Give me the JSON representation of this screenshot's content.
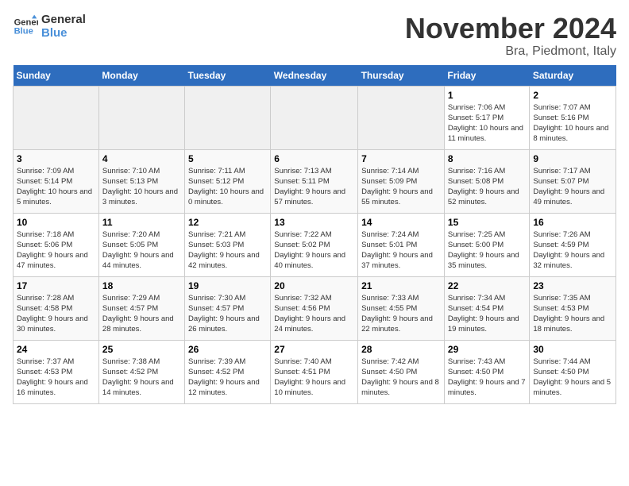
{
  "logo": {
    "line1": "General",
    "line2": "Blue"
  },
  "title": "November 2024",
  "location": "Bra, Piedmont, Italy",
  "weekdays": [
    "Sunday",
    "Monday",
    "Tuesday",
    "Wednesday",
    "Thursday",
    "Friday",
    "Saturday"
  ],
  "weeks": [
    [
      {
        "day": "",
        "info": ""
      },
      {
        "day": "",
        "info": ""
      },
      {
        "day": "",
        "info": ""
      },
      {
        "day": "",
        "info": ""
      },
      {
        "day": "",
        "info": ""
      },
      {
        "day": "1",
        "info": "Sunrise: 7:06 AM\nSunset: 5:17 PM\nDaylight: 10 hours and 11 minutes."
      },
      {
        "day": "2",
        "info": "Sunrise: 7:07 AM\nSunset: 5:16 PM\nDaylight: 10 hours and 8 minutes."
      }
    ],
    [
      {
        "day": "3",
        "info": "Sunrise: 7:09 AM\nSunset: 5:14 PM\nDaylight: 10 hours and 5 minutes."
      },
      {
        "day": "4",
        "info": "Sunrise: 7:10 AM\nSunset: 5:13 PM\nDaylight: 10 hours and 3 minutes."
      },
      {
        "day": "5",
        "info": "Sunrise: 7:11 AM\nSunset: 5:12 PM\nDaylight: 10 hours and 0 minutes."
      },
      {
        "day": "6",
        "info": "Sunrise: 7:13 AM\nSunset: 5:11 PM\nDaylight: 9 hours and 57 minutes."
      },
      {
        "day": "7",
        "info": "Sunrise: 7:14 AM\nSunset: 5:09 PM\nDaylight: 9 hours and 55 minutes."
      },
      {
        "day": "8",
        "info": "Sunrise: 7:16 AM\nSunset: 5:08 PM\nDaylight: 9 hours and 52 minutes."
      },
      {
        "day": "9",
        "info": "Sunrise: 7:17 AM\nSunset: 5:07 PM\nDaylight: 9 hours and 49 minutes."
      }
    ],
    [
      {
        "day": "10",
        "info": "Sunrise: 7:18 AM\nSunset: 5:06 PM\nDaylight: 9 hours and 47 minutes."
      },
      {
        "day": "11",
        "info": "Sunrise: 7:20 AM\nSunset: 5:05 PM\nDaylight: 9 hours and 44 minutes."
      },
      {
        "day": "12",
        "info": "Sunrise: 7:21 AM\nSunset: 5:03 PM\nDaylight: 9 hours and 42 minutes."
      },
      {
        "day": "13",
        "info": "Sunrise: 7:22 AM\nSunset: 5:02 PM\nDaylight: 9 hours and 40 minutes."
      },
      {
        "day": "14",
        "info": "Sunrise: 7:24 AM\nSunset: 5:01 PM\nDaylight: 9 hours and 37 minutes."
      },
      {
        "day": "15",
        "info": "Sunrise: 7:25 AM\nSunset: 5:00 PM\nDaylight: 9 hours and 35 minutes."
      },
      {
        "day": "16",
        "info": "Sunrise: 7:26 AM\nSunset: 4:59 PM\nDaylight: 9 hours and 32 minutes."
      }
    ],
    [
      {
        "day": "17",
        "info": "Sunrise: 7:28 AM\nSunset: 4:58 PM\nDaylight: 9 hours and 30 minutes."
      },
      {
        "day": "18",
        "info": "Sunrise: 7:29 AM\nSunset: 4:57 PM\nDaylight: 9 hours and 28 minutes."
      },
      {
        "day": "19",
        "info": "Sunrise: 7:30 AM\nSunset: 4:57 PM\nDaylight: 9 hours and 26 minutes."
      },
      {
        "day": "20",
        "info": "Sunrise: 7:32 AM\nSunset: 4:56 PM\nDaylight: 9 hours and 24 minutes."
      },
      {
        "day": "21",
        "info": "Sunrise: 7:33 AM\nSunset: 4:55 PM\nDaylight: 9 hours and 22 minutes."
      },
      {
        "day": "22",
        "info": "Sunrise: 7:34 AM\nSunset: 4:54 PM\nDaylight: 9 hours and 19 minutes."
      },
      {
        "day": "23",
        "info": "Sunrise: 7:35 AM\nSunset: 4:53 PM\nDaylight: 9 hours and 18 minutes."
      }
    ],
    [
      {
        "day": "24",
        "info": "Sunrise: 7:37 AM\nSunset: 4:53 PM\nDaylight: 9 hours and 16 minutes."
      },
      {
        "day": "25",
        "info": "Sunrise: 7:38 AM\nSunset: 4:52 PM\nDaylight: 9 hours and 14 minutes."
      },
      {
        "day": "26",
        "info": "Sunrise: 7:39 AM\nSunset: 4:52 PM\nDaylight: 9 hours and 12 minutes."
      },
      {
        "day": "27",
        "info": "Sunrise: 7:40 AM\nSunset: 4:51 PM\nDaylight: 9 hours and 10 minutes."
      },
      {
        "day": "28",
        "info": "Sunrise: 7:42 AM\nSunset: 4:50 PM\nDaylight: 9 hours and 8 minutes."
      },
      {
        "day": "29",
        "info": "Sunrise: 7:43 AM\nSunset: 4:50 PM\nDaylight: 9 hours and 7 minutes."
      },
      {
        "day": "30",
        "info": "Sunrise: 7:44 AM\nSunset: 4:50 PM\nDaylight: 9 hours and 5 minutes."
      }
    ]
  ]
}
